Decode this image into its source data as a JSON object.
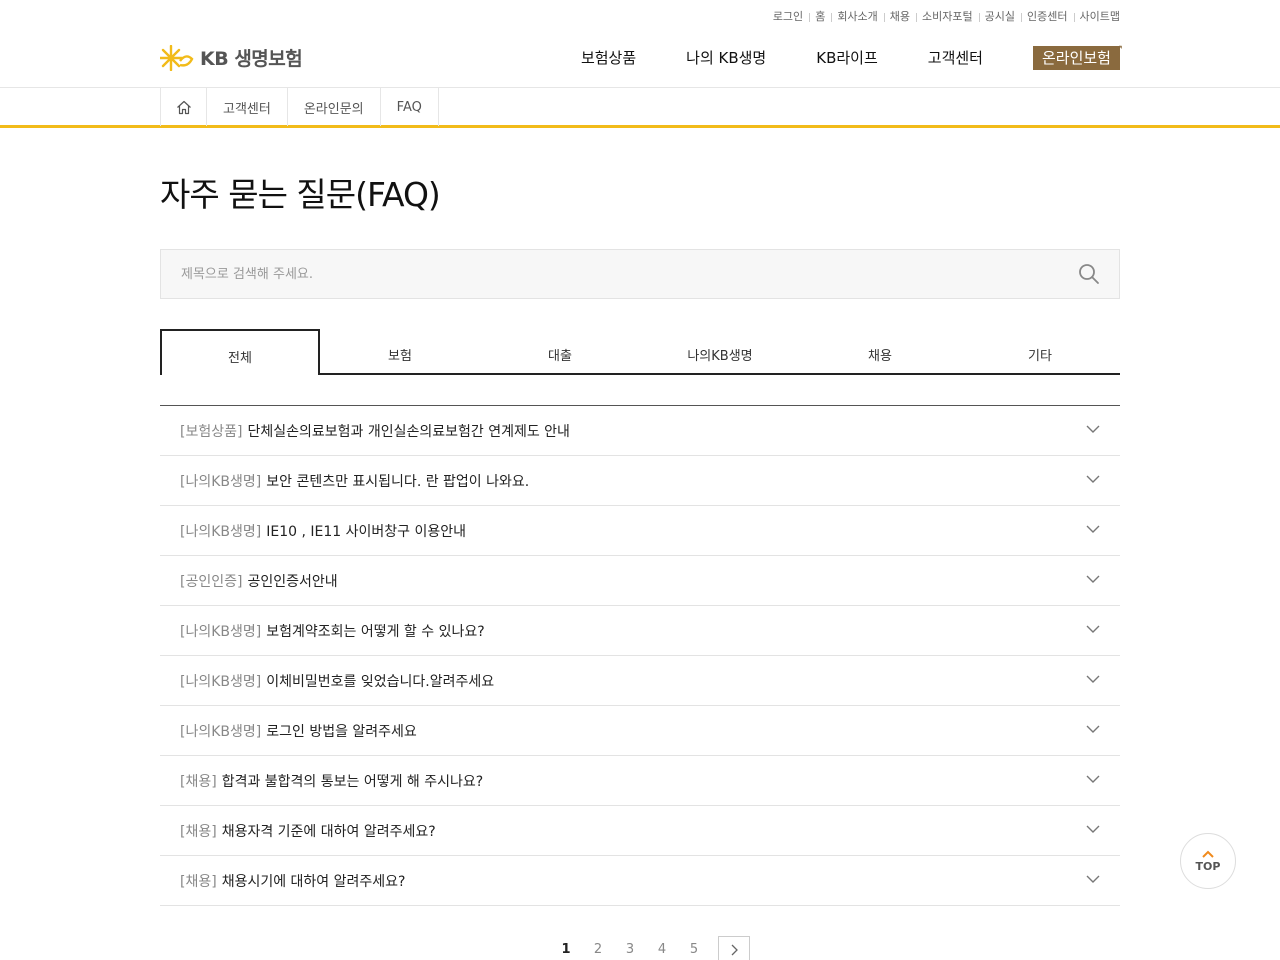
{
  "util_links": [
    "로그인",
    "홈",
    "회사소개",
    "채용",
    "소비자포털",
    "공시실",
    "인증센터",
    "사이트맵"
  ],
  "logo": {
    "text": "KB 생명보험"
  },
  "gnb": {
    "items": [
      "보험상품",
      "나의 KB생명",
      "KB라이프",
      "고객센터"
    ],
    "online": "온라인보험"
  },
  "breadcrumb": [
    "고객센터",
    "온라인문의",
    "FAQ"
  ],
  "page_title": "자주 묻는 질문(FAQ)",
  "search": {
    "placeholder": "제목으로 검색해 주세요."
  },
  "tabs": [
    {
      "label": "전체",
      "active": true
    },
    {
      "label": "보험",
      "active": false
    },
    {
      "label": "대출",
      "active": false
    },
    {
      "label": "나의KB생명",
      "active": false
    },
    {
      "label": "채용",
      "active": false
    },
    {
      "label": "기타",
      "active": false
    }
  ],
  "faq": [
    {
      "cat": "[보험상품]",
      "q": "단체실손의료보험과 개인실손의료보험간 연계제도 안내"
    },
    {
      "cat": "[나의KB생명]",
      "q": "보안 콘텐츠만 표시됩니다. 란 팝업이 나와요."
    },
    {
      "cat": "[나의KB생명]",
      "q": "IE10 , IE11 사이버창구 이용안내"
    },
    {
      "cat": "[공인인증]",
      "q": "공인인증서안내"
    },
    {
      "cat": "[나의KB생명]",
      "q": "보험계약조회는 어떻게 할 수 있나요?"
    },
    {
      "cat": "[나의KB생명]",
      "q": "이체비밀번호를 잊었습니다.알려주세요"
    },
    {
      "cat": "[나의KB생명]",
      "q": "로그인 방법을 알려주세요"
    },
    {
      "cat": "[채용]",
      "q": "합격과 불합격의 통보는 어떻게 해 주시나요?"
    },
    {
      "cat": "[채용]",
      "q": "채용자격 기준에 대하여 알려주세요?"
    },
    {
      "cat": "[채용]",
      "q": "채용시기에 대하여 알려주세요?"
    }
  ],
  "pager": {
    "pages": [
      "1",
      "2",
      "3",
      "4",
      "5"
    ],
    "current": "1"
  },
  "top_button": "TOP",
  "colors": {
    "accent": "#f2bb19",
    "online_bg": "#8a6a3e",
    "top_arrow": "#f08a1c"
  }
}
